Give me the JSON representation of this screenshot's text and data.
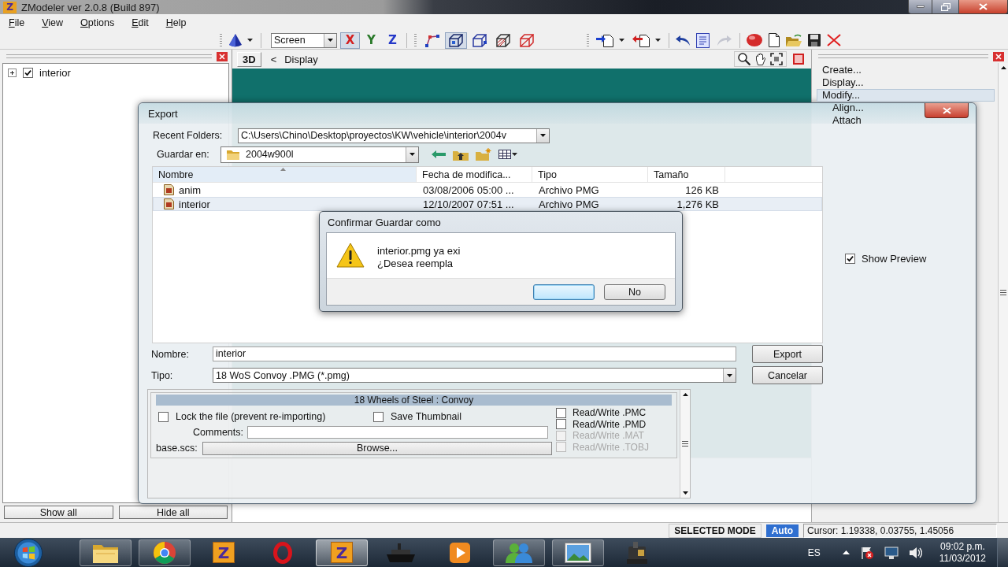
{
  "window": {
    "logo": "Z",
    "title": "ZModeler ver 2.0.8 (Build 897)"
  },
  "menu": [
    "File",
    "View",
    "Options",
    "Edit",
    "Help"
  ],
  "toolbar": {
    "coordinate_system": "Screen",
    "axes": [
      {
        "label": "X",
        "color": "#d42020",
        "selected": true
      },
      {
        "label": "Y",
        "color": "#2a7a2a",
        "selected": false
      },
      {
        "label": "Z",
        "color": "#2438c8",
        "selected": false
      }
    ],
    "selection_modes": [
      {
        "selected": false
      },
      {
        "selected": true
      },
      {
        "selected": false
      },
      {
        "selected": false
      },
      {
        "selected": false
      }
    ],
    "redo_disabled": true
  },
  "objects_panel": {
    "tree": [
      {
        "label": "interior",
        "checked": true,
        "expanded": false
      }
    ],
    "buttons": [
      "Show all",
      "Hide all"
    ]
  },
  "viewport": {
    "view": "3D",
    "back": "<",
    "title": "Display"
  },
  "commands_panel": {
    "items": [
      {
        "label": "Create...",
        "selected": false
      },
      {
        "label": "Display...",
        "selected": false
      },
      {
        "label": "Modify...",
        "selected": true,
        "children": [
          {
            "label": "Align...",
            "selected": false
          },
          {
            "label": "Attach",
            "selected": false
          }
        ]
      }
    ],
    "show_preview": {
      "label": "Show Preview",
      "checked": true
    }
  },
  "export_dialog": {
    "title": "Export",
    "recent_folders": {
      "label": "Recent Folders:",
      "value": "C:\\Users\\Chino\\Desktop\\proyectos\\KW\\vehicle\\interior\\2004v"
    },
    "save_in": {
      "label": "Guardar en:",
      "value": "2004w900l"
    },
    "file_list": {
      "columns": [
        {
          "label": "Nombre",
          "sorted": true
        },
        {
          "label": "Fecha de modifica...",
          "sorted": false
        },
        {
          "label": "Tipo",
          "sorted": false
        },
        {
          "label": "Tamaño",
          "sorted": false
        }
      ],
      "rows": [
        {
          "cells": [
            "anim",
            "03/08/2006 05:00 ...",
            "Archivo PMG",
            "126 KB"
          ],
          "selected": false
        },
        {
          "cells": [
            "interior",
            "12/10/2007 07:51 ...",
            "Archivo PMG",
            "1,276 KB"
          ],
          "selected": true
        }
      ]
    },
    "name_field": {
      "label": "Nombre:",
      "value": "interior"
    },
    "type_field": {
      "label": "Tipo:",
      "value": "18 WoS Convoy .PMG (*.pmg)"
    },
    "buttons": [
      "Export",
      "Cancelar"
    ],
    "options": {
      "title": "18 Wheels of Steel : Convoy",
      "checkboxes": [
        {
          "label": "Lock the file (prevent re-importing)",
          "checked": false
        },
        {
          "label": "Save Thumbnail",
          "checked": false
        }
      ],
      "comments_label": "Comments:",
      "base_label": "base.scs:",
      "browse": "Browse...",
      "read_write": [
        {
          "label": "Read/Write .PMC",
          "checked": false,
          "disabled": false
        },
        {
          "label": "Read/Write .PMD",
          "checked": false,
          "disabled": false
        },
        {
          "label": "Read/Write .MAT",
          "checked": false,
          "disabled": true
        },
        {
          "label": "Read/Write .TOBJ",
          "checked": false,
          "disabled": true
        }
      ]
    }
  },
  "confirm_dialog": {
    "title": "Confirmar Guardar como",
    "lines": [
      "interior.pmg ya exi",
      "¿Desea reempla"
    ],
    "buttons": [
      {
        "default": true
      },
      {
        "label": "No",
        "default": false
      }
    ]
  },
  "status_bar": {
    "mode": "SELECTED MODE",
    "snap": "Auto",
    "cursor": "Cursor: 1.19338, 0.03755, 1.45056"
  },
  "taskbar": {
    "apps": [
      {
        "kind": "icon",
        "running": true,
        "selected": false
      },
      {
        "kind": "icon",
        "running": true,
        "selected": false
      },
      {
        "kind": "letter",
        "letter": "Z",
        "running": false,
        "selected": false
      },
      {
        "kind": "icon",
        "running": false,
        "selected": false
      },
      {
        "kind": "letter",
        "letter": "Z",
        "running": true,
        "selected": true
      },
      {
        "kind": "icon",
        "running": false,
        "selected": false
      },
      {
        "kind": "icon",
        "running": false,
        "selected": false
      },
      {
        "kind": "icon",
        "running": true,
        "selected": false
      },
      {
        "kind": "icon",
        "running": true,
        "selected": false
      },
      {
        "kind": "icon",
        "running": false,
        "selected": false
      }
    ],
    "language": "ES",
    "time": "09:02 p.m.",
    "date": "11/03/2012"
  }
}
